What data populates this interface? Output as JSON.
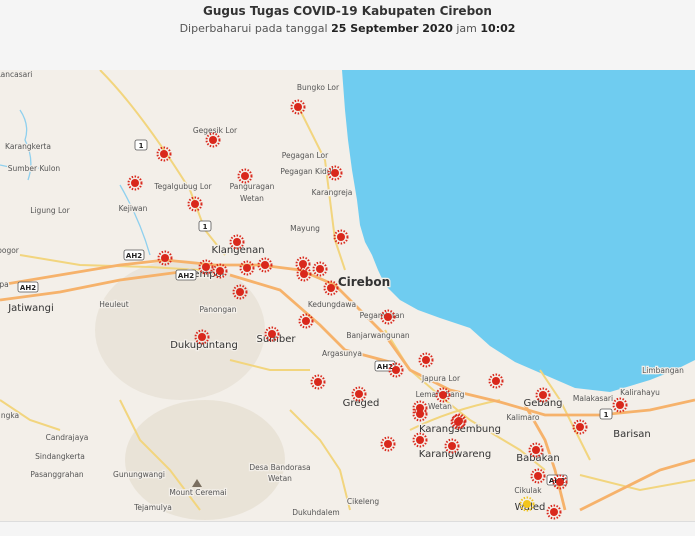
{
  "header": {
    "title": "Gugus Tugas COVID-19 Kabupaten Cirebon",
    "updated_prefix": "Diperbaharui pada tanggal",
    "updated_date": "25 September 2020",
    "updated_mid": "jam",
    "updated_time": "10:02"
  },
  "colors": {
    "sea": "#6fccf0",
    "land": "#f3efe9",
    "road_major": "#f6b26b",
    "road_minor": "#f2d57e",
    "marker": "#d9281c",
    "marker_yellow": "#f2c51b"
  },
  "map": {
    "places": [
      {
        "name": "Cirebon",
        "size": "large"
      },
      {
        "name": "Klangenan",
        "size": "medium"
      },
      {
        "name": "Gempol",
        "size": "medium"
      },
      {
        "name": "Dukupuntang",
        "size": "medium"
      },
      {
        "name": "Sumber",
        "size": "medium"
      },
      {
        "name": "Greged",
        "size": "medium"
      },
      {
        "name": "Karangsembung",
        "size": "medium"
      },
      {
        "name": "Karangwareng",
        "size": "medium"
      },
      {
        "name": "Gebang",
        "size": "medium"
      },
      {
        "name": "Babakan",
        "size": "medium"
      },
      {
        "name": "Barisan",
        "size": "medium"
      },
      {
        "name": "Jatiwangi",
        "size": "medium"
      },
      {
        "name": "Waled",
        "size": "medium"
      },
      {
        "name": "Bungko Lor",
        "size": "small"
      },
      {
        "name": "Gegesik Lor",
        "size": "small"
      },
      {
        "name": "Pegagan Lor",
        "size": "small"
      },
      {
        "name": "Pegagan Kidul",
        "size": "small"
      },
      {
        "name": "Karangreja",
        "size": "small"
      },
      {
        "name": "Panguragan",
        "size": "small"
      },
      {
        "name": "Wetan",
        "size": "small"
      },
      {
        "name": "Tegalgubug Lor",
        "size": "small"
      },
      {
        "name": "Kejiwan",
        "size": "small"
      },
      {
        "name": "Karangkerta",
        "size": "small"
      },
      {
        "name": "Sumber Kulon",
        "size": "small"
      },
      {
        "name": "Ligung Lor",
        "size": "small"
      },
      {
        "name": "Rancasari",
        "size": "small"
      },
      {
        "name": "Mayung",
        "size": "small"
      },
      {
        "name": "Kedungdawa",
        "size": "small"
      },
      {
        "name": "Pegambiran",
        "size": "small"
      },
      {
        "name": "Banjarwangunan",
        "size": "small"
      },
      {
        "name": "Panongan",
        "size": "small"
      },
      {
        "name": "Heuleut",
        "size": "small"
      },
      {
        "name": "Argasunya",
        "size": "small"
      },
      {
        "name": "Japura Lor",
        "size": "small"
      },
      {
        "name": "Lemahabang",
        "size": "small"
      },
      {
        "name": "Wetan",
        "size": "small"
      },
      {
        "name": "Kalimaro",
        "size": "small"
      },
      {
        "name": "Malakasari",
        "size": "small"
      },
      {
        "name": "Kalirahayu",
        "size": "small"
      },
      {
        "name": "Limbangan",
        "size": "small"
      },
      {
        "name": "Cikulak",
        "size": "small"
      },
      {
        "name": "Candrajaya",
        "size": "small"
      },
      {
        "name": "Sindangkerta",
        "size": "small"
      },
      {
        "name": "Pasanggrahan",
        "size": "small"
      },
      {
        "name": "Gunungwangi",
        "size": "small"
      },
      {
        "name": "Mount Ceremai",
        "size": "small"
      },
      {
        "name": "Desa Bandorasa",
        "size": "small"
      },
      {
        "name": "Wetan",
        "size": "small"
      },
      {
        "name": "Tejamulya",
        "size": "small"
      },
      {
        "name": "Dukuhdalem",
        "size": "small"
      },
      {
        "name": "Cikeleng",
        "size": "small"
      },
      {
        "name": "ngka",
        "size": "small"
      },
      {
        "name": "bogor",
        "size": "small"
      },
      {
        "name": "pa",
        "size": "small"
      }
    ],
    "road_shields": [
      {
        "label": "1"
      },
      {
        "label": "1"
      },
      {
        "label": "AH2"
      },
      {
        "label": "AH2"
      },
      {
        "label": "AH2"
      },
      {
        "label": "AH2"
      },
      {
        "label": "1"
      },
      {
        "label": "AH2"
      }
    ],
    "marker_count": 44
  }
}
